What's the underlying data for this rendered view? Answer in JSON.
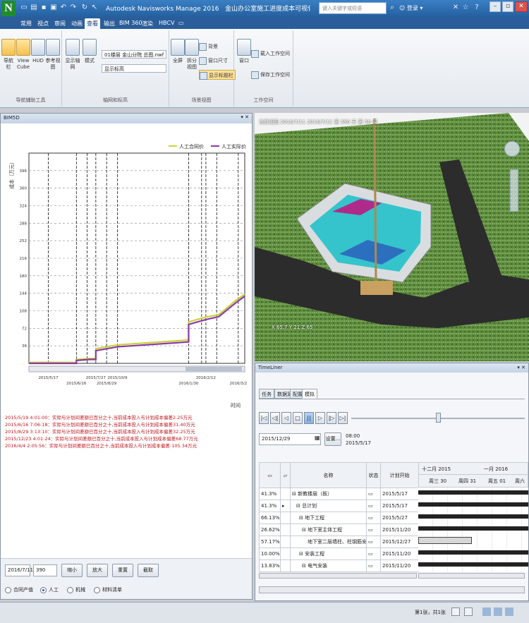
{
  "titlebar": {
    "logo": "N",
    "app_name": "Autodesk Navisworks Manage 2016",
    "file_name": "金山办公室施工进度成本可视化模型160907.nwd",
    "search_placeholder": "键入关键字或短语",
    "signin_label": "登录",
    "help": "?"
  },
  "ribbon_tabs": [
    "常用",
    "视点",
    "审阅",
    "动画",
    "查看",
    "输出",
    "BIM 360",
    "渲染",
    "HBCV",
    "▭"
  ],
  "active_tab": "查看",
  "ribbon": {
    "groups": [
      {
        "title": "导航辅助工具",
        "buttons": [
          "导航栏",
          "View Cube",
          "HUD",
          "参考视图"
        ]
      },
      {
        "title": "轴网和标高",
        "buttons": [
          "显示轴网",
          "模式"
        ],
        "dropdowns": [
          "01楼层 金山分院 总图.nwf",
          "显示标高"
        ]
      },
      {
        "title": "场景视图",
        "buttons": [
          "全屏",
          "拆分视图"
        ],
        "small": [
          "背景",
          "窗口尺寸",
          "显示标题栏"
        ]
      },
      {
        "title": "工作空间",
        "buttons": [
          "窗口"
        ],
        "small": [
          "载入工作空间",
          "保存工作空间"
        ]
      }
    ]
  },
  "left_panel": {
    "title": "BIM5D",
    "footer_input_date": "2016/7/11",
    "footer_input_value": "390",
    "buttons": [
      "缩小",
      "放大",
      "重置",
      "截取"
    ],
    "radios": [
      {
        "label": "合同产值",
        "checked": false
      },
      {
        "label": "人工",
        "checked": true
      },
      {
        "label": "机械",
        "checked": false
      },
      {
        "label": "材料清单",
        "checked": false
      }
    ]
  },
  "chart_data": {
    "type": "line",
    "ylabel": "成本（万元）",
    "xlabel": "时间",
    "legend_position": "top-right",
    "yticks": [
      "36",
      "72",
      "108",
      "144",
      "180",
      "216",
      "252",
      "288",
      "324",
      "360",
      "396"
    ],
    "ylim": [
      0,
      432
    ],
    "xlim": [
      0,
      1
    ],
    "xticks": [
      {
        "x": 0.09,
        "label": "2015/5/17"
      },
      {
        "x": 0.22,
        "label": "2015/6/16"
      },
      {
        "x": 0.31,
        "label": "2015/7/27"
      },
      {
        "x": 0.36,
        "label": "2015/8/29"
      },
      {
        "x": 0.41,
        "label": "2015/10/9"
      },
      {
        "x": 0.74,
        "label": "2016/1/30"
      },
      {
        "x": 0.82,
        "label": "2016/2/12"
      },
      {
        "x": 0.97,
        "label": "2016/3/2"
      }
    ],
    "vlines": [
      0.09,
      0.22,
      0.27,
      0.31,
      0.36,
      0.41,
      0.74,
      0.8,
      0.82,
      0.87,
      0.97
    ],
    "series": [
      {
        "name": "人工合同价",
        "color": "#c8d23a",
        "x": [
          0,
          0.09,
          0.22,
          0.22,
          0.28,
          0.31,
          0.31,
          0.41,
          0.74,
          0.74,
          0.82,
          0.88,
          0.96,
          1.0
        ],
        "y": [
          2,
          2,
          2,
          8,
          10,
          10,
          30,
          38,
          48,
          85,
          95,
          100,
          130,
          142
        ]
      },
      {
        "name": "人工实际价",
        "color": "#8b3aa6",
        "x": [
          0,
          0.09,
          0.22,
          0.22,
          0.28,
          0.31,
          0.31,
          0.41,
          0.74,
          0.74,
          0.82,
          0.88,
          0.96,
          1.0
        ],
        "y": [
          0,
          0,
          0,
          6,
          8,
          8,
          26,
          34,
          44,
          80,
          90,
          96,
          125,
          138
        ]
      }
    ]
  },
  "messages": [
    "2015/5/19 4:01:00：实际与计划间差额已百分之十,当前成本投入与计划成本偏差2.25万元",
    "2015/6/16 7:06:18：实际与计划间差额已百分之十,当前成本投入与计划成本偏差31.40万元",
    "2015/8/29 3:13:10：实际与计划间差额已百分之十,当前成本投入与计划成本偏差32.25万元",
    "2015/12/23 4:01:24：实际与计划间差额已百分之十,当前成本投入与计划成本偏差68.77万元",
    "2016/4/4 2:05:56：实际与计划间差额已百分之十,当前成本投入与计划成本偏差-105.34万元"
  ],
  "viewport": {
    "label": "当前视图 2016/7/11 2016/7/11 第 390 天 第 56 周",
    "coord": "X 65.7 Y 21 Z 65"
  },
  "timeliner": {
    "title": "TimeLiner",
    "tabs": [
      "任务",
      "数据源",
      "配置",
      "模拟"
    ],
    "active_tab": "模拟",
    "date_field": "2015/12/29",
    "settings_btn": "设置...",
    "time": "08:00",
    "date": "2015/5/17",
    "columns": [
      "",
      "",
      "名称",
      "状态",
      "计划开始"
    ],
    "rows": [
      {
        "pct": "41.3%",
        "name": "新教楼层（板）",
        "bold": true,
        "start": "2015/5/17"
      },
      {
        "pct": "41.3%",
        "name": "总计划",
        "bold": true,
        "start": "2015/5/17"
      },
      {
        "pct": "66.13%",
        "name": "地下工程",
        "bold": true,
        "start": "2015/5/27"
      },
      {
        "pct": "26.62%",
        "name": "地下室主体工程",
        "bold": true,
        "start": "2015/11/20"
      },
      {
        "pct": "57.17%",
        "name": "地下室二层墙柱、柱钢筋安装",
        "bold": false,
        "start": "2015/12/27"
      },
      {
        "pct": "10.00%",
        "name": "安装工程",
        "bold": true,
        "start": "2015/11/20"
      },
      {
        "pct": "13.83%",
        "name": "电气安装",
        "bold": true,
        "start": "2015/11/20"
      }
    ],
    "gantt_months": [
      "十二月 2015",
      "一月 2016"
    ],
    "gantt_days": [
      "周三 30",
      "周四 31",
      "周五 01",
      "周六"
    ]
  },
  "status": {
    "page": "第1张，共1张"
  }
}
